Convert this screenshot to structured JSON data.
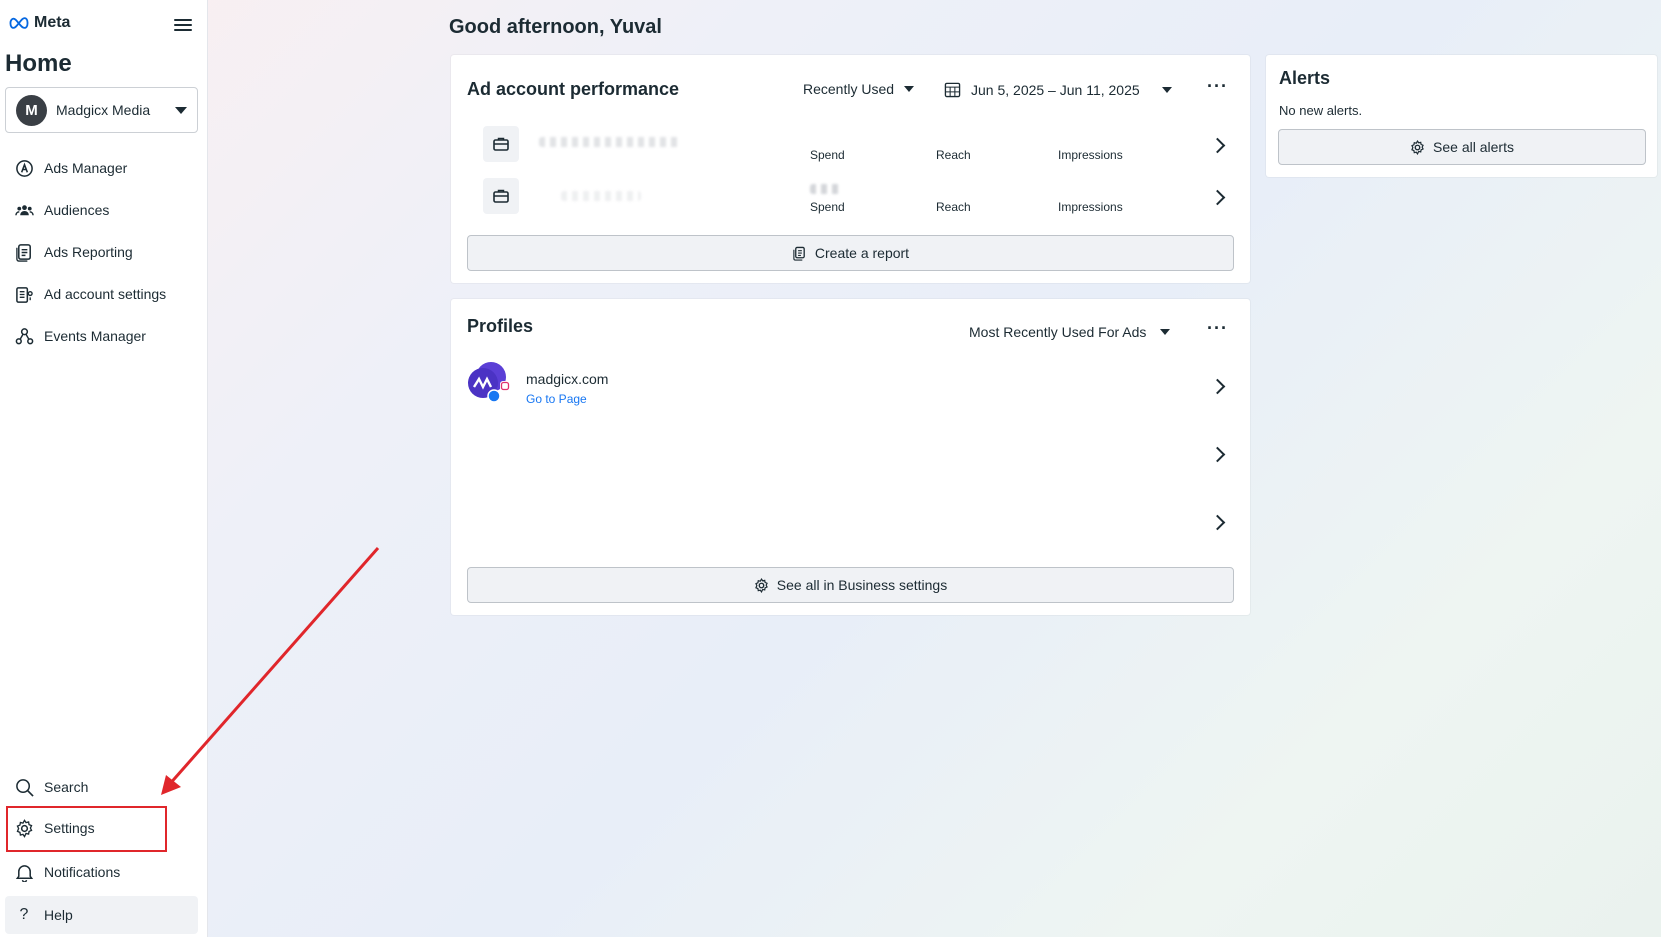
{
  "sidebar": {
    "brand": "Meta",
    "page_title": "Home",
    "account": {
      "initial": "M",
      "name": "Madgicx Media"
    },
    "nav_items": [
      {
        "label": "Ads Manager",
        "icon": "ads-manager-icon"
      },
      {
        "label": "Audiences",
        "icon": "audiences-icon"
      },
      {
        "label": "Ads Reporting",
        "icon": "ads-reporting-icon"
      },
      {
        "label": "Ad account settings",
        "icon": "ad-account-settings-icon"
      },
      {
        "label": "Events Manager",
        "icon": "events-manager-icon"
      }
    ],
    "bottom_items": [
      {
        "label": "Search",
        "icon": "search-icon"
      },
      {
        "label": "Settings",
        "icon": "gear-icon"
      },
      {
        "label": "Notifications",
        "icon": "bell-icon"
      },
      {
        "label": "Help",
        "icon": "help-icon"
      }
    ]
  },
  "greeting": "Good afternoon, Yuval",
  "ad_performance": {
    "title": "Ad account performance",
    "sort_label": "Recently Used",
    "date_range": "Jun 5, 2025 – Jun 11, 2025",
    "rows": [
      {
        "metrics": [
          "Spend",
          "Reach",
          "Impressions"
        ]
      },
      {
        "metrics": [
          "Spend",
          "Reach",
          "Impressions"
        ]
      }
    ],
    "create_report_label": "Create a report"
  },
  "profiles": {
    "title": "Profiles",
    "sort_label": "Most Recently Used For Ads",
    "items": [
      {
        "name": "madgicx.com",
        "link": "Go to Page"
      }
    ],
    "see_all_label": "See all in Business settings"
  },
  "alerts": {
    "title": "Alerts",
    "subtitle": "No new alerts.",
    "see_all_label": "See all alerts"
  },
  "colors": {
    "accent_blue": "#1877f2",
    "highlight_red": "#e0262b",
    "text_primary": "#1c2b33"
  }
}
